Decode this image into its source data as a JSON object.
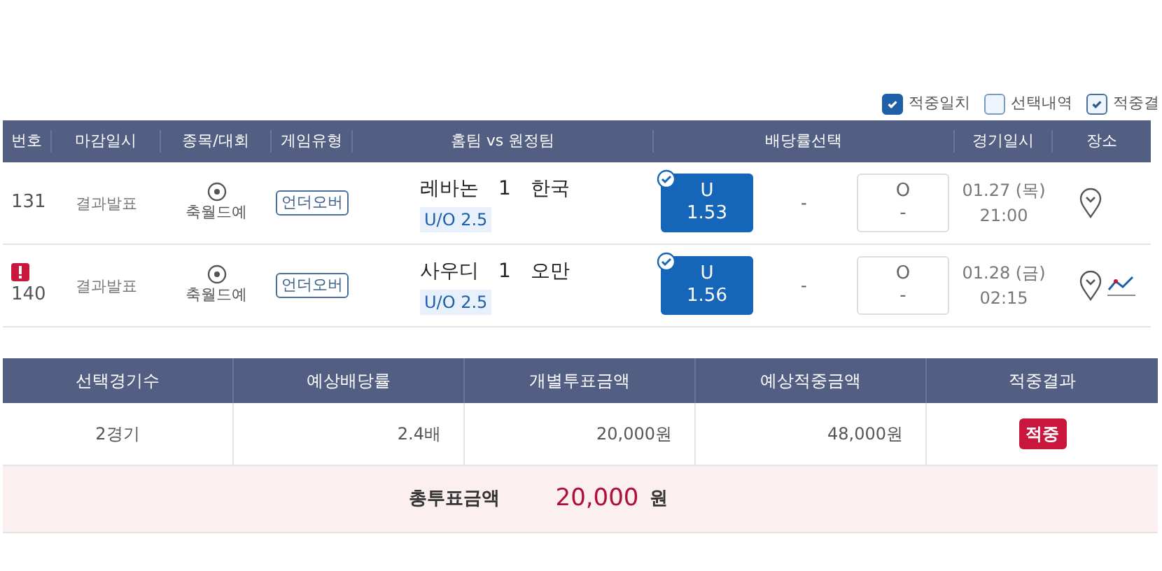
{
  "filters": [
    {
      "label": "적중일치",
      "checked": true,
      "kind": "filled"
    },
    {
      "label": "선택내역",
      "checked": false,
      "kind": "outline"
    },
    {
      "label": "적중결",
      "checked": true,
      "kind": "outline"
    }
  ],
  "games": {
    "columns": [
      "번호",
      "마감일시",
      "종목/대회",
      "게임유형",
      "홈팀 vs 원정팀",
      "배당률선택",
      "경기일시",
      "장소"
    ],
    "rows": [
      {
        "number": "131",
        "warning": false,
        "deadline": "결과발표",
        "league": "축월드예",
        "game_type": "언더오버",
        "home": "레바논",
        "score": "1",
        "away": "한국",
        "handicap": "U/O 2.5",
        "under": {
          "label": "U",
          "odds": "1.53",
          "selected": true
        },
        "draw": "-",
        "over": {
          "label": "O",
          "odds": "-",
          "selected": false
        },
        "date": "01.27 (목)",
        "time": "21:00",
        "chart": false
      },
      {
        "number": "140",
        "warning": true,
        "deadline": "결과발표",
        "league": "축월드예",
        "game_type": "언더오버",
        "home": "사우디",
        "score": "1",
        "away": "오만",
        "handicap": "U/O 2.5",
        "under": {
          "label": "U",
          "odds": "1.56",
          "selected": true
        },
        "draw": "-",
        "over": {
          "label": "O",
          "odds": "-",
          "selected": false
        },
        "date": "01.28 (금)",
        "time": "02:15",
        "chart": true
      }
    ]
  },
  "summary": {
    "columns": [
      "선택경기수",
      "예상배당률",
      "개별투표금액",
      "예상적중금액",
      "적중결과"
    ],
    "values": [
      "2경기",
      "2.4배",
      "20,000원",
      "48,000원"
    ],
    "result": "적중",
    "total_label": "총투표금액",
    "total_amount": "20,000",
    "total_unit": "원"
  }
}
